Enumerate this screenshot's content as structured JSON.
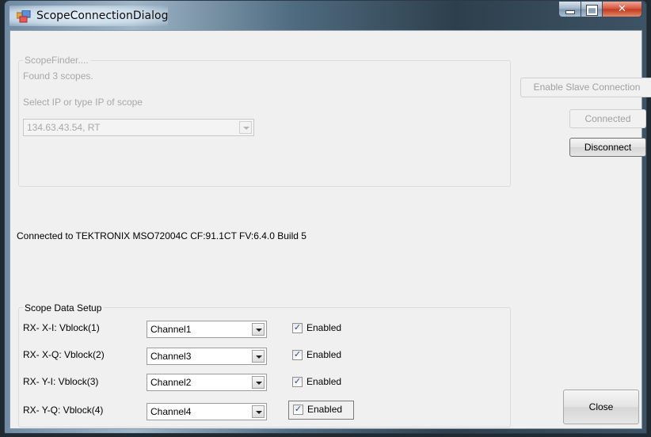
{
  "window": {
    "title": "ScopeConnectionDialog"
  },
  "scope_finder": {
    "group_label": "ScopeFinder....",
    "status": "Found 3 scopes.",
    "select_label": "Select IP or type IP of scope",
    "selected_ip": "134.63.43.54, RT"
  },
  "buttons": {
    "enable_slave": "Enable Slave Connection",
    "connected": "Connected",
    "disconnect": "Disconnect",
    "close": "Close"
  },
  "connection_status": "Connected to TEKTRONIX MSO72004C CF:91.1CT FV:6.4.0 Build 5",
  "data_setup": {
    "group_label": "Scope Data Setup",
    "rows": [
      {
        "label": "RX- X-I:  Vblock(1)",
        "channel": "Channel1",
        "enabled_label": "Enabled",
        "enabled": true
      },
      {
        "label": "RX- X-Q: Vblock(2)",
        "channel": "Channel3",
        "enabled_label": "Enabled",
        "enabled": true
      },
      {
        "label": "RX- Y-I:  Vblock(3)",
        "channel": "Channel2",
        "enabled_label": "Enabled",
        "enabled": true
      },
      {
        "label": "RX- Y-Q: Vblock(4)",
        "channel": "Channel4",
        "enabled_label": "Enabled",
        "enabled": true
      }
    ]
  },
  "icons": {
    "app": "window-app-icon",
    "minimize": "minimize-icon",
    "maximize": "maximize-icon",
    "close": "close-icon",
    "dropdown": "chevron-down-icon",
    "check": "checkmark-icon"
  }
}
